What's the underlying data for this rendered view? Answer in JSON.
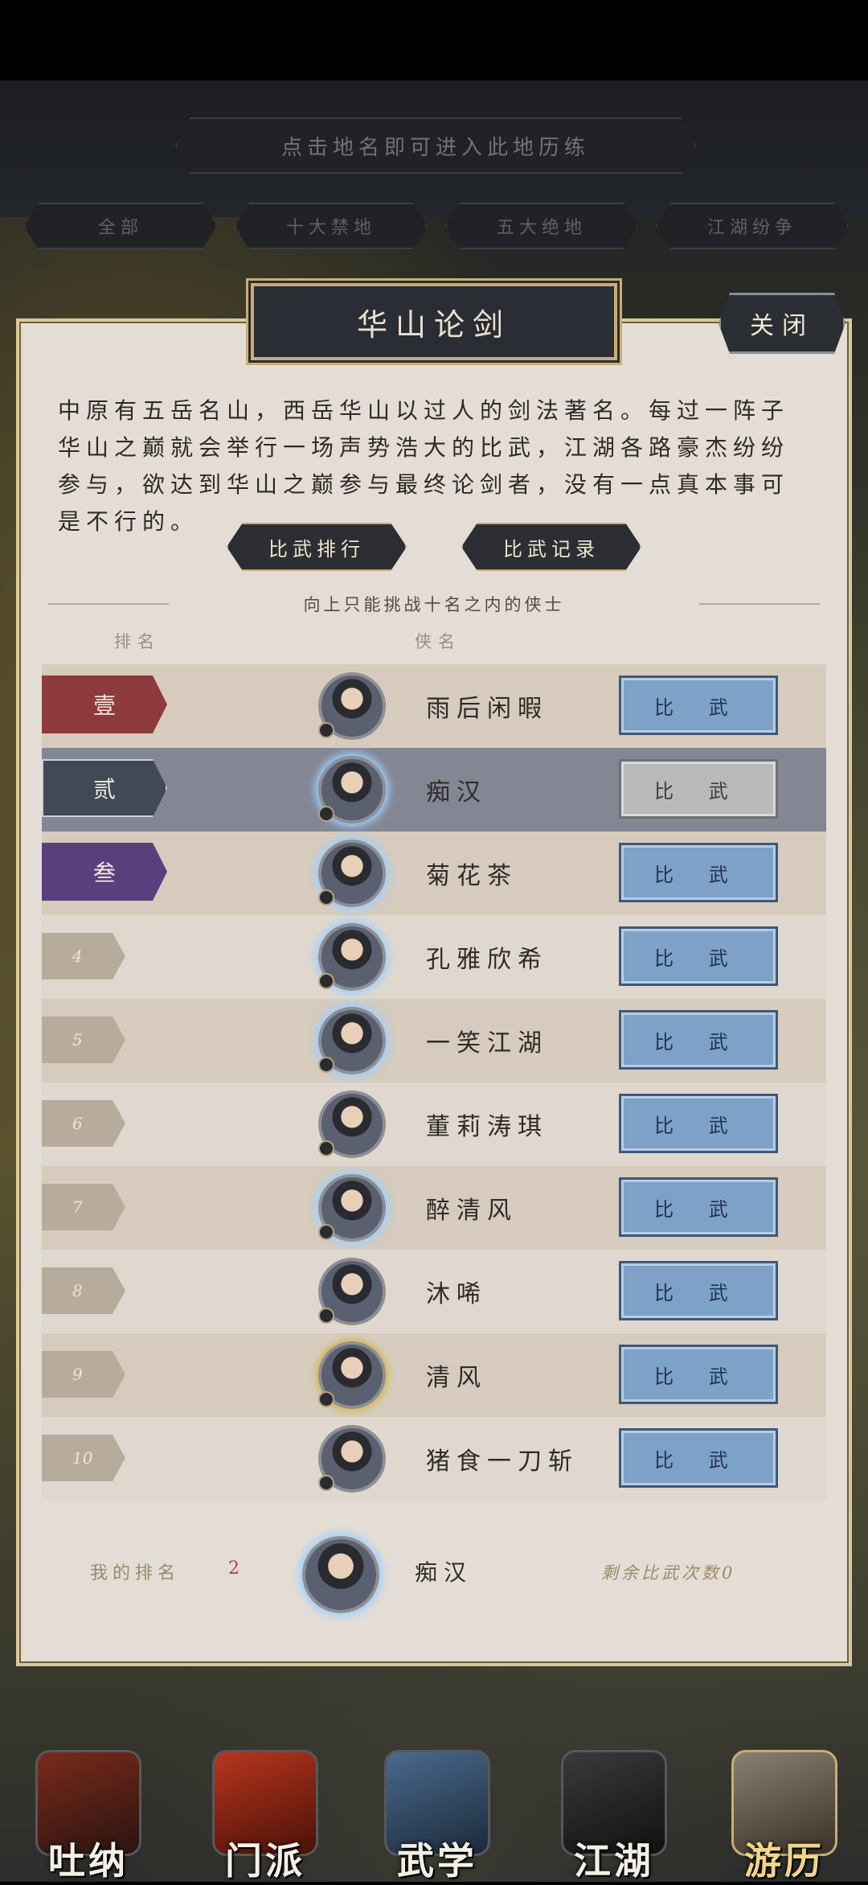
{
  "hint": "点击地名即可进入此地历练",
  "filter_tabs": [
    "全部",
    "十大禁地",
    "五大绝地",
    "江湖纷争"
  ],
  "panel": {
    "title": "华山论剑",
    "close": "关闭",
    "description": "中原有五岳名山，西岳华山以过人的剑法著名。每过一阵子华山之巅就会举行一场声势浩大的比武，江湖各路豪杰纷纷参与，欲达到华山之巅参与最终论剑者，没有一点真本事可是不行的。",
    "tab_rank": "比武排行",
    "tab_record": "比武记录",
    "challenge_hint": "向上只能挑战十名之内的侠士",
    "col_rank": "排名",
    "col_name": "侠名",
    "fight_label": "比 武",
    "rows": [
      {
        "rank": "壹",
        "name": "雨后闲暇",
        "badge_color": "#8f3a3c"
      },
      {
        "rank": "贰",
        "name": "痴汉",
        "badge_color": "#3f4a54"
      },
      {
        "rank": "叁",
        "name": "菊花茶",
        "badge_color": "#5a3f7e"
      },
      {
        "rank": "4",
        "name": "孔雅欣希"
      },
      {
        "rank": "5",
        "name": "一笑江湖"
      },
      {
        "rank": "6",
        "name": "董莉涛琪"
      },
      {
        "rank": "7",
        "name": "醉清风"
      },
      {
        "rank": "8",
        "name": "沐唏"
      },
      {
        "rank": "9",
        "name": "清风"
      },
      {
        "rank": "10",
        "name": "猪食一刀斩"
      }
    ],
    "my_rank_label": "我的排名",
    "my_rank": "2",
    "my_name": "痴汉",
    "remaining": "剩余比武次数0"
  },
  "nav": [
    "吐纳",
    "门派",
    "武学",
    "江湖",
    "游历"
  ]
}
